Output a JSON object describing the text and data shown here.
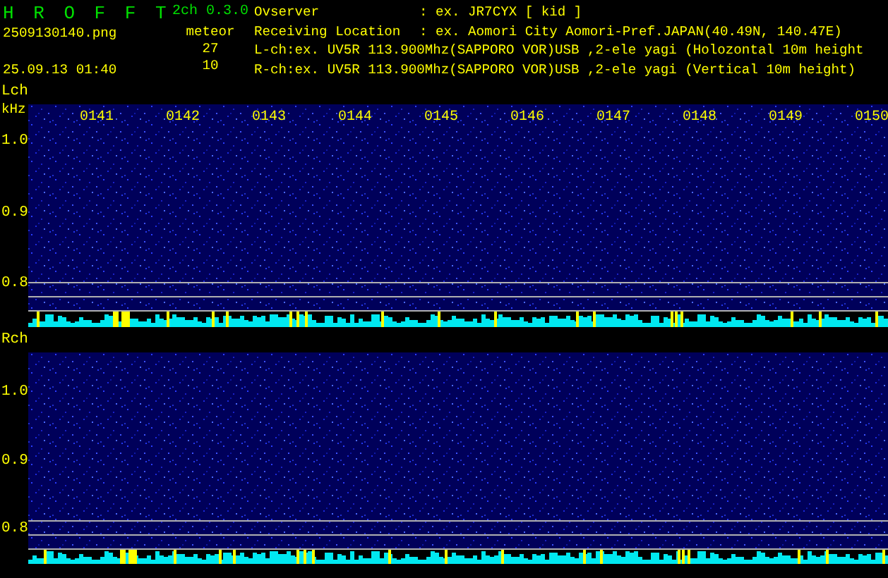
{
  "header": {
    "app_title": "H R O F F T",
    "version": "2ch 0.3.0",
    "filename": "2509130140.png",
    "mode": "meteor",
    "datetime": "25.09.13 01:40",
    "counts": [
      "27",
      "10"
    ],
    "info_rows": [
      {
        "label": "Ovserver",
        "value": ": ex. JR7CYX [ kid ]"
      },
      {
        "label": "Receiving Location",
        "value": ": ex. Aomori City Aomori-Pref.JAPAN(40.49N, 140.47E)"
      }
    ],
    "channel_lines": [
      "L-ch:ex. UV5R 113.900Mhz(SAPPORO VOR)USB ,2-ele yagi (Holozontal 10m height",
      "R-ch:ex. UV5R 113.900Mhz(SAPPORO VOR)USB ,2-ele yagi (Vertical 10m height)"
    ]
  },
  "panels": [
    {
      "label": "Lch",
      "unit": "kHz",
      "y_ticks": [
        "1.0",
        "0.9",
        "0.8"
      ],
      "time_labels": [
        "0141",
        "0142",
        "0143",
        "0144",
        "0145",
        "0146",
        "0147",
        "0148",
        "0149",
        "0150"
      ]
    },
    {
      "label": "Rch",
      "y_ticks": [
        "1.0",
        "0.9",
        "0.8"
      ]
    }
  ]
}
